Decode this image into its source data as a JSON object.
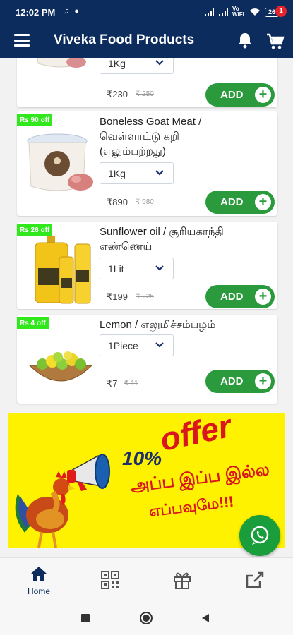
{
  "status_bar": {
    "time": "12:02 PM",
    "network_label": "Vo WiFi",
    "battery": "26"
  },
  "app_bar": {
    "title": "Viveka Food Products",
    "cart_count": "1",
    "menu_icon": "hamburger-icon",
    "notification_icon": "bell-icon",
    "cart_icon": "cart-icon"
  },
  "products": [
    {
      "name_line1": "",
      "name_line2": "",
      "name_line3": "",
      "unit": "1Kg",
      "price": "₹230",
      "mrp": "₹ 250",
      "add_label": "ADD"
    },
    {
      "offer": "Rs 90 off",
      "name_line1": "Boneless Goat Meat /",
      "name_line2": "வெள்ளாட்டு கறி",
      "name_line3": "(எலும்பற்றது)",
      "unit": "1Kg",
      "price": "₹890",
      "mrp": "₹ 980",
      "add_label": "ADD"
    },
    {
      "offer": "Rs 26 off",
      "name_line1": "Sunflower oil / சூரியகாந்தி",
      "name_line2": "எண்ணெய்",
      "unit": "1Lit",
      "price": "₹199",
      "mrp": "₹ 225",
      "add_label": "ADD"
    },
    {
      "offer": "Rs 4 off",
      "name_line1": "Lemon / எலுமிச்சம்பழம்",
      "unit": "1Piece",
      "price": "₹7",
      "mrp": "₹ 11",
      "add_label": "ADD"
    }
  ],
  "banner": {
    "offer_percent": "10%",
    "offer_word": "offer",
    "tamil_line1": "அப்ப இப்ப இல்ல",
    "tamil_line2": "எப்பவுமே!!!"
  },
  "bottom_nav": {
    "items": [
      {
        "label": "Home",
        "icon": "home-icon",
        "active": true
      },
      {
        "label": "",
        "icon": "qr-code-icon"
      },
      {
        "label": "",
        "icon": "gift-icon"
      },
      {
        "label": "",
        "icon": "share-icon"
      }
    ]
  },
  "colors": {
    "primary": "#0b2c5c",
    "add_green": "#2a9a3c",
    "offer_green": "#31e81d",
    "banner_yellow": "#fff200",
    "banner_red": "#d9161c"
  }
}
